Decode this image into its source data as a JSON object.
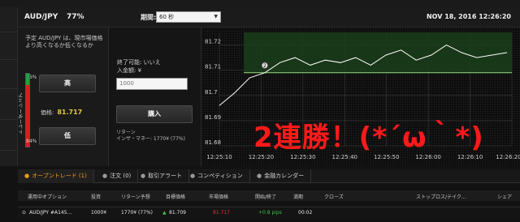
{
  "header": {
    "pair": "AUD/JPY",
    "payout_pct": "77%",
    "expiry_label": "期間:",
    "expiry_value": "60 秒",
    "datetime": "NOV 18, 2016 12:26:20"
  },
  "panel": {
    "note": "予定 AUD/JPY は、現市場価格より高くなるか低くなるか",
    "high_pct": "16%",
    "low_pct": "84%",
    "gauge_label": "トレーダーシェア",
    "high_button": "高",
    "low_button": "低",
    "price_label": "価格:",
    "price_value": "81.717"
  },
  "order": {
    "end_label": "終了可能: いいえ",
    "amount_label": "入金額: ¥",
    "amount_placeholder": "1000",
    "buy_button": "購入",
    "return_label": "リターン",
    "itm_label": "インザ・マネー: 1770¥ (77%)"
  },
  "chart_data": {
    "type": "line",
    "x": [
      "12:25:10",
      "12:25:20",
      "12:25:30",
      "12:25:40",
      "12:25:50",
      "12:26:00",
      "12:26:10",
      "12:26:20"
    ],
    "yticks": [
      "81.72",
      "81.71",
      "81.7",
      "81.69",
      "81.68"
    ],
    "ylim": [
      81.68,
      81.725
    ],
    "strike_label": "2",
    "strike_price": 81.709,
    "series": [
      {
        "values": [
          81.696,
          81.701,
          81.707,
          81.709,
          81.713,
          81.715,
          81.712,
          81.714,
          81.713,
          81.715,
          81.712,
          81.716,
          81.718,
          81.714,
          81.716,
          81.72,
          81.717,
          81.715,
          81.716,
          81.717
        ]
      }
    ],
    "colors": {
      "line": "#ffffff",
      "grid": "#3a3a3a",
      "in_money": "#1a3d1a",
      "strike": "#9be07a"
    }
  },
  "overlay_text": "2連勝！(*´ω｀*)",
  "tabs": [
    {
      "label": "オープントレード (1)"
    },
    {
      "label": "注文 (0)"
    },
    {
      "label": "取引アラート"
    },
    {
      "label": "コンペティション"
    },
    {
      "label": "金融カレンダー"
    }
  ],
  "table": {
    "headers": [
      "運用中オプション",
      "投資",
      "リターン予想",
      "目標価格",
      "市場価格",
      "開始/終了",
      "満期",
      "クローズ",
      "ストップロス/テイク...",
      "シェア"
    ],
    "row": [
      "AUD/JPY #A145...",
      "1000¥",
      "1770¥ (77%)",
      "81.709",
      "81.717",
      "+0.8 pips",
      "00:02"
    ]
  }
}
